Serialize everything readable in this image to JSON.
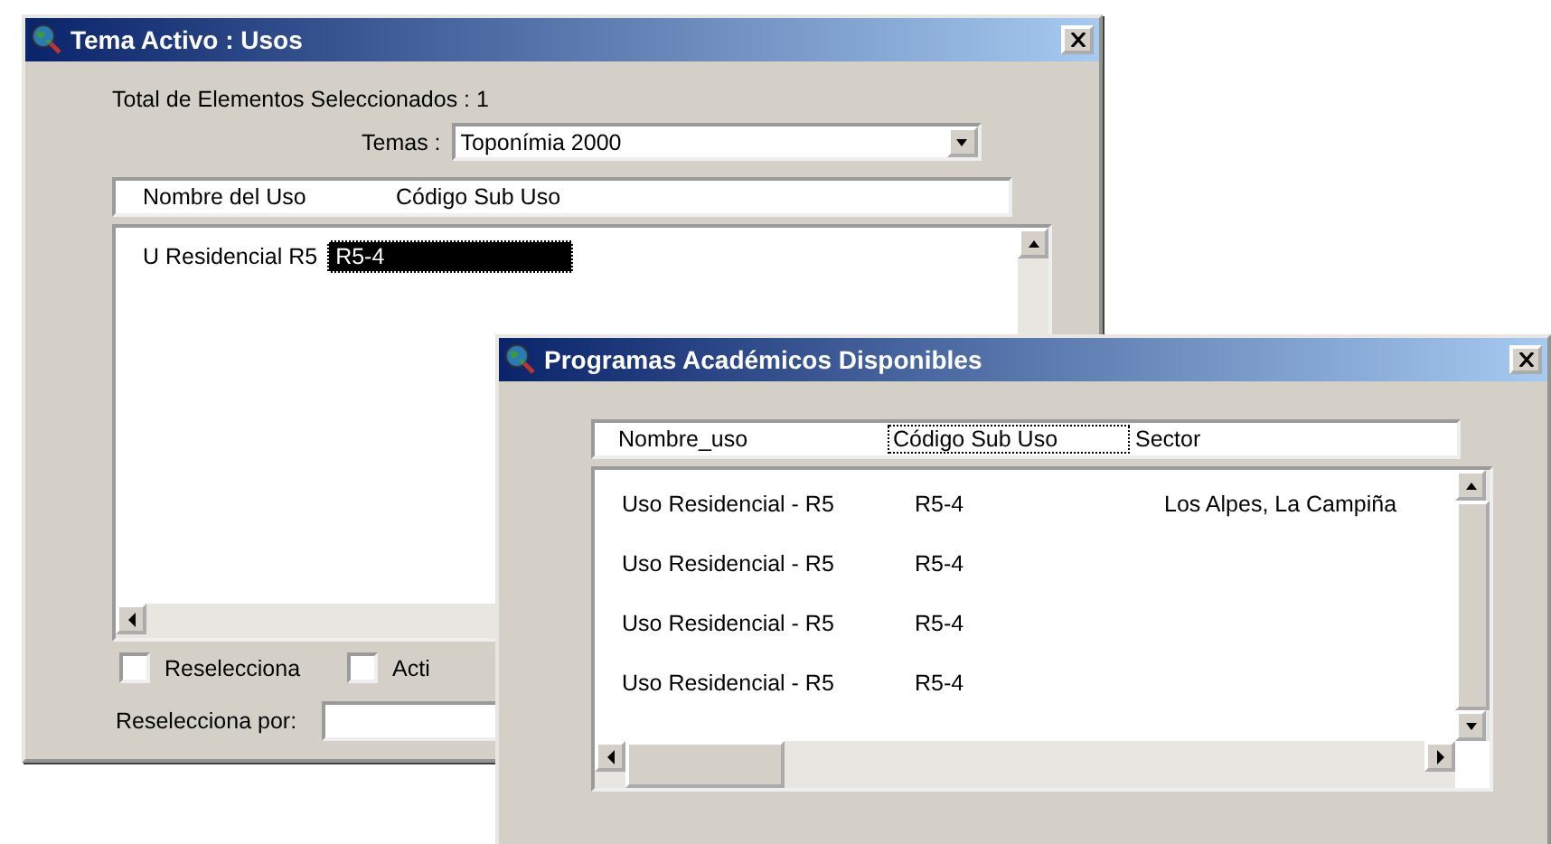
{
  "windows": [
    {
      "title": "Tema Activo : Usos",
      "total_label": "Total de Elementos Seleccionados : 1",
      "temas": {
        "label": "Temas  :",
        "value": "Toponímia 2000"
      },
      "list": {
        "columns": [
          {
            "label": "Nombre del Uso",
            "focused": false
          },
          {
            "label": "Código Sub Uso",
            "focused": false
          }
        ],
        "rows": [
          {
            "name": "U Residencial R5",
            "code": "R5-4",
            "selected": true
          }
        ]
      },
      "checkboxes": [
        {
          "label": "Reselecciona",
          "checked": false
        },
        {
          "label": "Acti",
          "checked": false
        }
      ],
      "reselect_field": {
        "label": "Reselecciona por:"
      }
    },
    {
      "title": "Programas Académicos Disponibles",
      "list": {
        "columns": [
          {
            "label": "Nombre_uso",
            "focused": false
          },
          {
            "label": "Código Sub Uso",
            "focused": true
          },
          {
            "label": "Sector",
            "focused": false
          }
        ],
        "rows": [
          {
            "name": "Uso Residencial - R5",
            "code": "R5-4",
            "sector": "Los Alpes, La Campiña",
            "selected": false
          },
          {
            "name": "Uso Residencial - R5",
            "code": "R5-4",
            "selected": false
          },
          {
            "name": "Uso Residencial - R5",
            "code": "R5-4",
            "selected": false
          },
          {
            "name": "Uso Residencial - R5",
            "code": "R5-4",
            "selected": false
          }
        ]
      }
    }
  ]
}
